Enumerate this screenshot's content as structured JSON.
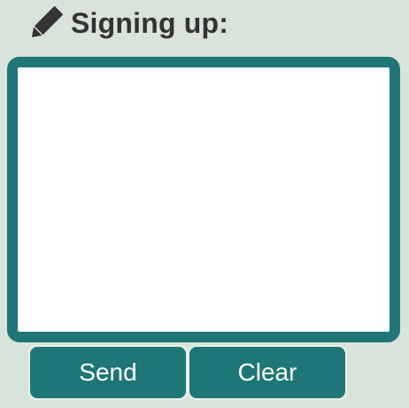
{
  "header": {
    "icon": "pencil-icon",
    "title": "Signing up:"
  },
  "canvas": {
    "accent_color": "#1f7676",
    "background_color": "#ffffff"
  },
  "buttons": {
    "send_label": "Send",
    "clear_label": "Clear",
    "color": "#1f7676"
  }
}
